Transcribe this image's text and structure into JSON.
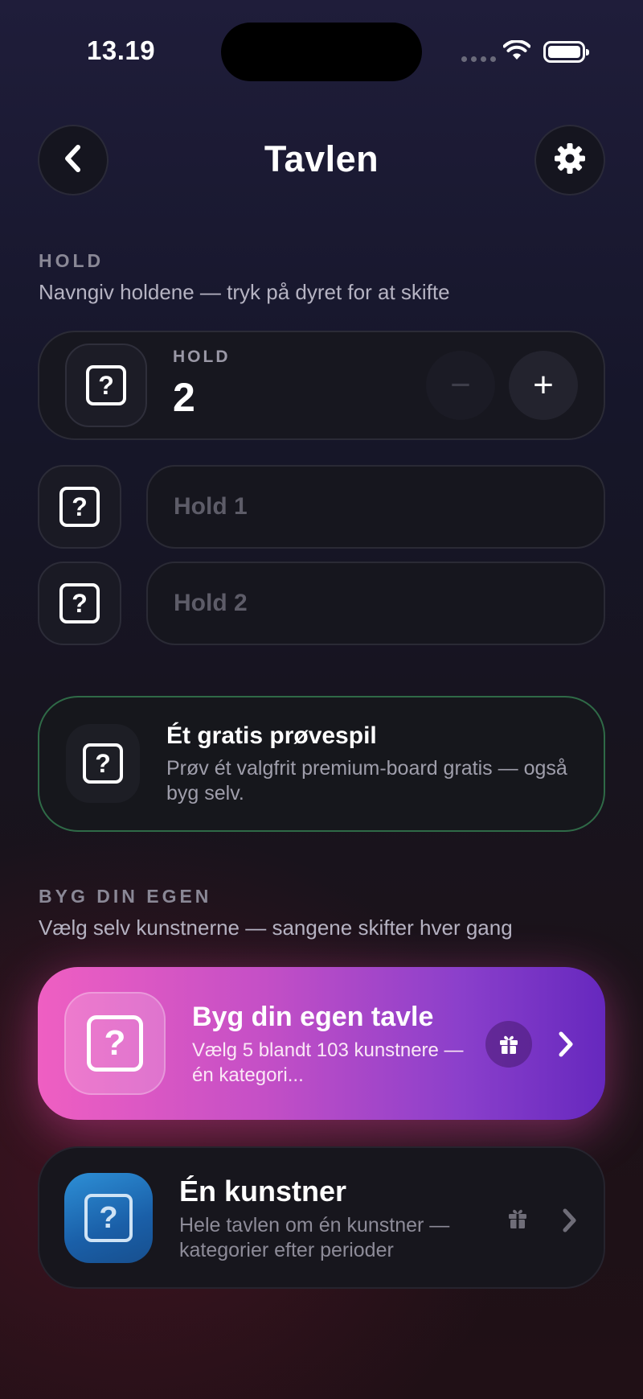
{
  "status_bar": {
    "time": "13.19"
  },
  "header": {
    "title": "Tavlen"
  },
  "teams_section": {
    "label": "HOLD",
    "subtitle": "Navngiv holdene — tryk på dyret for at skifte",
    "count_label": "HOLD",
    "count": "2",
    "minus": "−",
    "plus": "+",
    "teams": [
      {
        "placeholder": "Hold 1",
        "value": ""
      },
      {
        "placeholder": "Hold 2",
        "value": ""
      }
    ]
  },
  "trial_card": {
    "title": "Ét gratis prøvespil",
    "description": "Prøv ét valgfrit premium-board gratis — også byg selv."
  },
  "build_section": {
    "label": "BYG DIN EGEN",
    "subtitle": "Vælg selv kunstnerne — sangene skifter hver gang",
    "build_card": {
      "title": "Byg din egen tavle",
      "description": "Vælg 5 blandt 103 kunstnere — én kategori..."
    },
    "artist_card": {
      "title": "Én kunstner",
      "description": "Hele tavlen om én kunstner — kategorier efter perioder"
    }
  },
  "icons": {
    "back": "chevron-left-icon",
    "settings": "gear-icon",
    "avatar": "question-mark-icon",
    "gift": "gift-icon",
    "chevron": "chevron-right-icon"
  },
  "colors": {
    "trial_border": "#2f6a47",
    "build_gradient_start": "#ef5fc2",
    "build_gradient_end": "#6628be",
    "artist_icon": "#2d8fd6"
  }
}
